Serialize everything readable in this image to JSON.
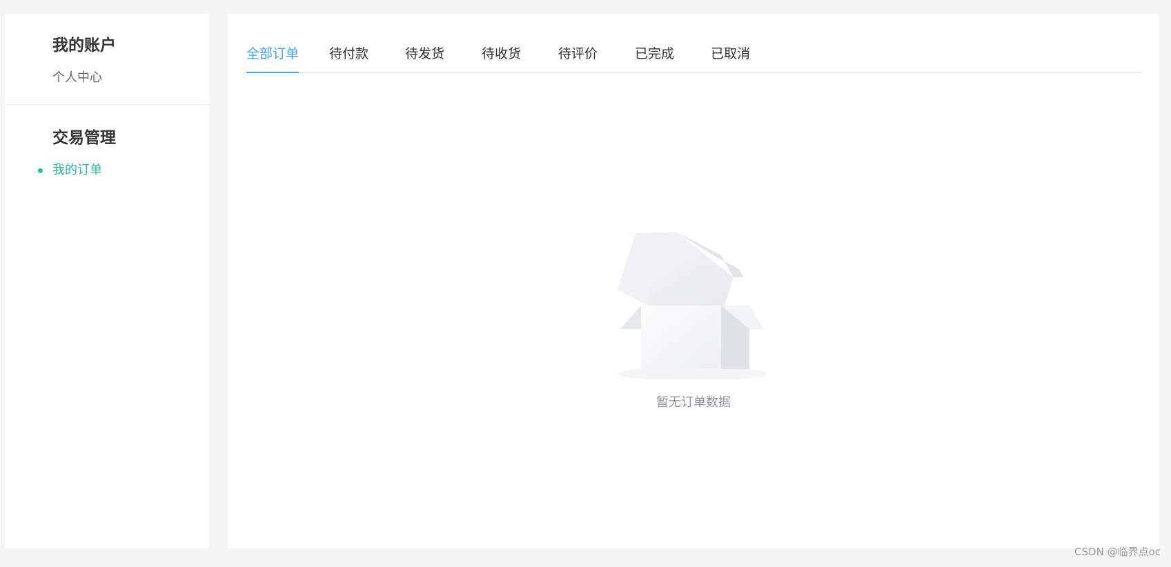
{
  "sidebar": {
    "groups": [
      {
        "title": "我的账户",
        "items": [
          {
            "label": "个人中心",
            "active": false
          }
        ]
      },
      {
        "title": "交易管理",
        "items": [
          {
            "label": "我的订单",
            "active": true
          }
        ]
      }
    ]
  },
  "tabs": {
    "items": [
      {
        "label": "全部订单",
        "active": true
      },
      {
        "label": "待付款",
        "active": false
      },
      {
        "label": "待发货",
        "active": false
      },
      {
        "label": "待收货",
        "active": false
      },
      {
        "label": "待评价",
        "active": false
      },
      {
        "label": "已完成",
        "active": false
      },
      {
        "label": "已取消",
        "active": false
      }
    ]
  },
  "empty_state": {
    "icon": "empty-box-icon",
    "text": "暂无订单数据"
  },
  "watermark": {
    "text": "CSDN @临界点oc"
  },
  "colors": {
    "accent_tab": "#409eff",
    "accent_side": "#27ba9b",
    "background": "#f5f5f5"
  }
}
